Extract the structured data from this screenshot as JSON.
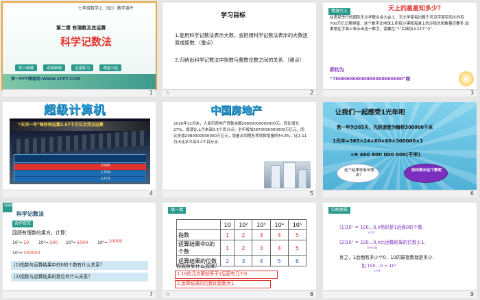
{
  "slide1": {
    "number": "1",
    "header_line1": "七年级数学上（BD）教学课件",
    "chapter": "第二章 有理数及其运算",
    "title": "科学记数法",
    "buttons": [
      "导入新课",
      "讲授新课",
      "当堂练习",
      "课堂小结"
    ],
    "footer": "第一PPT模板网-WWW.1PPT.COM"
  },
  "slide2": {
    "number": "2",
    "heading": "学习目标",
    "item1": "1.能用科学记数法表示大数，会把用科学记数法表示的大数还原成原数.（重点）",
    "item2": "2.归纳出科学记数法中指数与整数位数之间的关系.（难点）"
  },
  "slide3": {
    "number": "3",
    "tag": "情境引入",
    "question": "天上的星星知多少？",
    "body": "在悉尼举行的国际天文学联合会大会上，天文学家指出整个可见宇宙空间大约有700万亿亿颗恒星，这个数字比地球上所有沙漠和海滩上的沙砾总和数量还要多.如果想在字面上表示出这一数字，需要在“7”后面加上22个“0”.",
    "answer_label": "即约为",
    "answer_value": "“70000000000000000000000”颗"
  },
  "slide4": {
    "number": "4",
    "title": "超级计算机",
    "banner": "“天河一号”每秒钟运算2.57千万亿次浮点运算",
    "row_values": [
      "2566",
      "1759",
      "1271"
    ]
  },
  "slide5": {
    "number": "5",
    "title": "中国房地产",
    "body": "2016年12月末，人民币房地产贷款余额26680000000000元，同比增长27%，增速比上月末高0.5个百分点；全年增加5670000000000万亿元，同比多增2080000000000万亿元，增量占同期各项贷款增量的44.8%，比1-11月占比水平高0.2个百分点."
  },
  "slide6": {
    "number": "6",
    "heading": "让我们一起感受1光年吧",
    "line1": "若一年为365天，光的速度为每秒300000千米",
    "line2": "1光年=365×24×60×60×300000×1",
    "line3": "=9 460 800 000 000(千米)",
    "cloud1": "这个结果你有何想法？",
    "cloud2": "如何表示这个数呢"
  },
  "slide7": {
    "number": "7",
    "corner": "讲授新课",
    "title": "科学记数法",
    "subtag": "合作探究",
    "intro": "回顾有理数的乘方，计算：",
    "powers": [
      "10¹=",
      "10²=",
      "10³=",
      "10⁴=",
      "10⁵="
    ],
    "answers": [
      "10",
      "100",
      "1000",
      "10000",
      "100000"
    ],
    "q1": "(1)指数与运算结果中的0的个数有什么关系？",
    "q2": "(2)指数与运算结果的数位有什么关系？"
  },
  "slide8": {
    "number": "8",
    "tag": "填一填",
    "headers": [
      "",
      "10",
      "10²",
      "10³",
      "10⁴",
      "10⁵"
    ],
    "rows": [
      {
        "label": "指数",
        "values": [
          "1",
          "2",
          "3",
          "4",
          "5"
        ]
      },
      {
        "label": "运算结果中0的个数",
        "values": [
          "1",
          "2",
          "3",
          "4",
          "5"
        ]
      },
      {
        "label": "运算结果的位数",
        "values": [
          "2",
          "3",
          "4",
          "5",
          "6"
        ]
      }
    ],
    "question": "你观察到什么规律？",
    "rule1": "1.10的几次幂就等于1后面有几个0.",
    "rule2": "2.运算结果的位数比指数大1."
  },
  "slide9": {
    "number": "9",
    "tag": "归纳总结",
    "rule1": "(1)10ⁿ = 100…0,n恰好是1后面0的个数.",
    "rule1_brace": "n个0",
    "rule2": "(2)10ⁿ = 100…0,n比运算结果的位数少1.",
    "rule2_brace": "(n+1)位",
    "reverse": "反之，1后面有多少个0，10的幂指数就是多少.",
    "reverse_formula": "如 100…0 = 10ⁿ",
    "reverse_brace": "n个0"
  },
  "colors": {
    "teal": "#2a9a8c",
    "red": "#e0322c",
    "purple": "#7b2fbf",
    "gold": "#c89b2a",
    "sky": "#6cc7e6"
  }
}
